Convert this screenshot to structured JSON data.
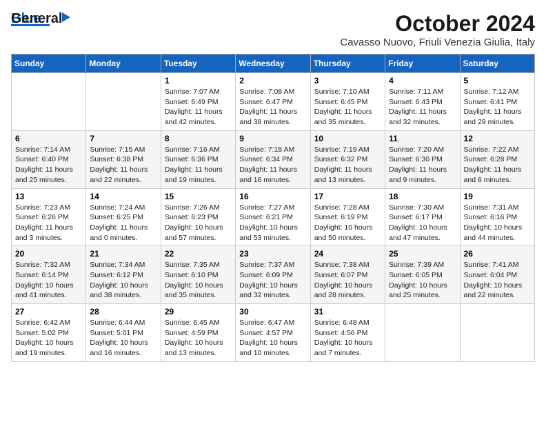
{
  "header": {
    "logo_line1": "General",
    "logo_line2": "Blue",
    "month_year": "October 2024",
    "location": "Cavasso Nuovo, Friuli Venezia Giulia, Italy"
  },
  "weekdays": [
    "Sunday",
    "Monday",
    "Tuesday",
    "Wednesday",
    "Thursday",
    "Friday",
    "Saturday"
  ],
  "weeks": [
    [
      {
        "day": "",
        "info": ""
      },
      {
        "day": "",
        "info": ""
      },
      {
        "day": "1",
        "info": "Sunrise: 7:07 AM\nSunset: 6:49 PM\nDaylight: 11 hours and 42 minutes."
      },
      {
        "day": "2",
        "info": "Sunrise: 7:08 AM\nSunset: 6:47 PM\nDaylight: 11 hours and 38 minutes."
      },
      {
        "day": "3",
        "info": "Sunrise: 7:10 AM\nSunset: 6:45 PM\nDaylight: 11 hours and 35 minutes."
      },
      {
        "day": "4",
        "info": "Sunrise: 7:11 AM\nSunset: 6:43 PM\nDaylight: 11 hours and 32 minutes."
      },
      {
        "day": "5",
        "info": "Sunrise: 7:12 AM\nSunset: 6:41 PM\nDaylight: 11 hours and 29 minutes."
      }
    ],
    [
      {
        "day": "6",
        "info": "Sunrise: 7:14 AM\nSunset: 6:40 PM\nDaylight: 11 hours and 25 minutes."
      },
      {
        "day": "7",
        "info": "Sunrise: 7:15 AM\nSunset: 6:38 PM\nDaylight: 11 hours and 22 minutes."
      },
      {
        "day": "8",
        "info": "Sunrise: 7:16 AM\nSunset: 6:36 PM\nDaylight: 11 hours and 19 minutes."
      },
      {
        "day": "9",
        "info": "Sunrise: 7:18 AM\nSunset: 6:34 PM\nDaylight: 11 hours and 16 minutes."
      },
      {
        "day": "10",
        "info": "Sunrise: 7:19 AM\nSunset: 6:32 PM\nDaylight: 11 hours and 13 minutes."
      },
      {
        "day": "11",
        "info": "Sunrise: 7:20 AM\nSunset: 6:30 PM\nDaylight: 11 hours and 9 minutes."
      },
      {
        "day": "12",
        "info": "Sunrise: 7:22 AM\nSunset: 6:28 PM\nDaylight: 11 hours and 6 minutes."
      }
    ],
    [
      {
        "day": "13",
        "info": "Sunrise: 7:23 AM\nSunset: 6:26 PM\nDaylight: 11 hours and 3 minutes."
      },
      {
        "day": "14",
        "info": "Sunrise: 7:24 AM\nSunset: 6:25 PM\nDaylight: 11 hours and 0 minutes."
      },
      {
        "day": "15",
        "info": "Sunrise: 7:26 AM\nSunset: 6:23 PM\nDaylight: 10 hours and 57 minutes."
      },
      {
        "day": "16",
        "info": "Sunrise: 7:27 AM\nSunset: 6:21 PM\nDaylight: 10 hours and 53 minutes."
      },
      {
        "day": "17",
        "info": "Sunrise: 7:28 AM\nSunset: 6:19 PM\nDaylight: 10 hours and 50 minutes."
      },
      {
        "day": "18",
        "info": "Sunrise: 7:30 AM\nSunset: 6:17 PM\nDaylight: 10 hours and 47 minutes."
      },
      {
        "day": "19",
        "info": "Sunrise: 7:31 AM\nSunset: 6:16 PM\nDaylight: 10 hours and 44 minutes."
      }
    ],
    [
      {
        "day": "20",
        "info": "Sunrise: 7:32 AM\nSunset: 6:14 PM\nDaylight: 10 hours and 41 minutes."
      },
      {
        "day": "21",
        "info": "Sunrise: 7:34 AM\nSunset: 6:12 PM\nDaylight: 10 hours and 38 minutes."
      },
      {
        "day": "22",
        "info": "Sunrise: 7:35 AM\nSunset: 6:10 PM\nDaylight: 10 hours and 35 minutes."
      },
      {
        "day": "23",
        "info": "Sunrise: 7:37 AM\nSunset: 6:09 PM\nDaylight: 10 hours and 32 minutes."
      },
      {
        "day": "24",
        "info": "Sunrise: 7:38 AM\nSunset: 6:07 PM\nDaylight: 10 hours and 28 minutes."
      },
      {
        "day": "25",
        "info": "Sunrise: 7:39 AM\nSunset: 6:05 PM\nDaylight: 10 hours and 25 minutes."
      },
      {
        "day": "26",
        "info": "Sunrise: 7:41 AM\nSunset: 6:04 PM\nDaylight: 10 hours and 22 minutes."
      }
    ],
    [
      {
        "day": "27",
        "info": "Sunrise: 6:42 AM\nSunset: 5:02 PM\nDaylight: 10 hours and 19 minutes."
      },
      {
        "day": "28",
        "info": "Sunrise: 6:44 AM\nSunset: 5:01 PM\nDaylight: 10 hours and 16 minutes."
      },
      {
        "day": "29",
        "info": "Sunrise: 6:45 AM\nSunset: 4:59 PM\nDaylight: 10 hours and 13 minutes."
      },
      {
        "day": "30",
        "info": "Sunrise: 6:47 AM\nSunset: 4:57 PM\nDaylight: 10 hours and 10 minutes."
      },
      {
        "day": "31",
        "info": "Sunrise: 6:48 AM\nSunset: 4:56 PM\nDaylight: 10 hours and 7 minutes."
      },
      {
        "day": "",
        "info": ""
      },
      {
        "day": "",
        "info": ""
      }
    ]
  ]
}
